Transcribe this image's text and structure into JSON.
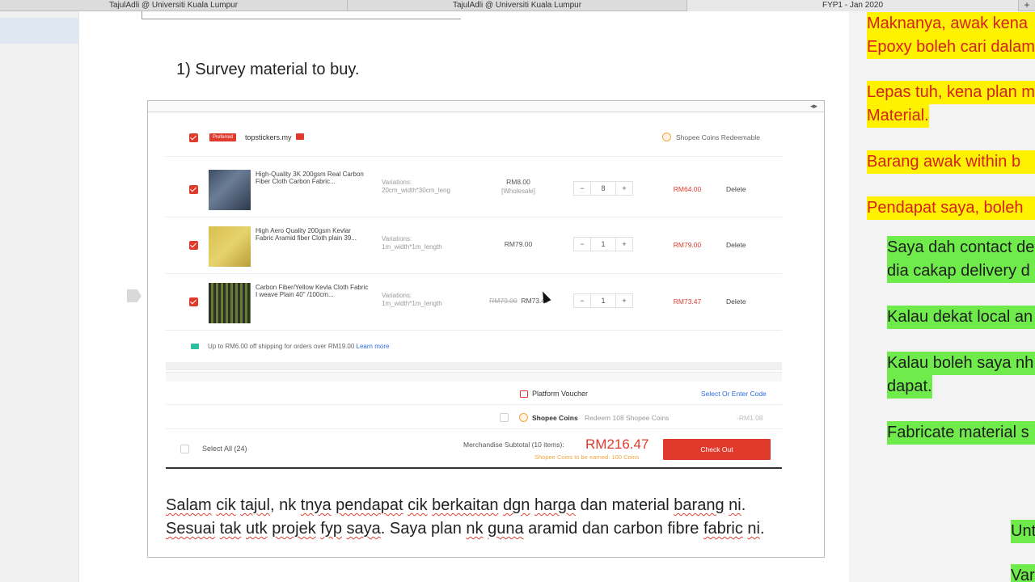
{
  "browser": {
    "tabs": [
      {
        "label": "TajulAdli @ Universiti Kuala Lumpur"
      },
      {
        "label": "TajulAdli @ Universiti Kuala Lumpur"
      },
      {
        "label": "FYP1 - Jan 2020"
      }
    ],
    "new_tab": "+"
  },
  "document": {
    "heading": "1) Survey material to buy.",
    "frame_nav": "◂▸",
    "comment_line1": [
      "Salam",
      "cik",
      "tajul",
      ", nk",
      "tnya",
      "pendapat",
      "cik",
      "berkaitan",
      "dgn",
      "harga",
      "dan material",
      "barang",
      "ni",
      "."
    ],
    "comment_line2": [
      "Sesuai",
      "tak",
      "utk",
      "projek",
      "fyp",
      "saya",
      ". Saya plan",
      "nk",
      "guna",
      "aramid dan carbon fibre",
      "fabric",
      "ni",
      "."
    ]
  },
  "shopee": {
    "badge": "Preferred",
    "shop_name": "topstickers.my",
    "coins_redeemable": "Shopee Coins Redeemable",
    "items": [
      {
        "name": "High-Quality 3K 200gsm Real Carbon Fiber Cloth Carbon Fabric...",
        "variation_label": "Variations:",
        "variation_value": "20cm_width*30cm_leng",
        "price": "RM8.00",
        "price_sub": "[Wholesale]",
        "qty": "8",
        "total": "RM64.00",
        "delete": "Delete"
      },
      {
        "name": "High Aero Quality 200gsm Kevlar Fabric Aramid fiber Cloth plain 39...",
        "variation_label": "Variations:",
        "variation_value": "1m_width*1m_length",
        "price": "RM79.00",
        "qty": "1",
        "total": "RM79.00",
        "delete": "Delete"
      },
      {
        "name": "Carbon Fiber/Yellow Kevla Cloth Fabric I weave Plain 40\" /100cm...",
        "variation_label": "Variations:",
        "variation_value": "1m_width*1m_length",
        "price_old": "RM79.00",
        "price": "RM73.47",
        "qty": "1",
        "total": "RM73.47",
        "delete": "Delete"
      }
    ],
    "qty_minus": "−",
    "qty_plus": "+",
    "shipping_text": "Up to RM6.00 off shipping for orders over RM19.00",
    "shipping_link": "Learn more",
    "voucher_label": "Platform Voucher",
    "voucher_link": "Select Or Enter Code",
    "coins_label": "Shopee Coins",
    "coins_redeem": "Redeem 108 Shopee Coins",
    "coins_amount": "-RM1.08",
    "select_all": "Select All (24)",
    "subtotal_label": "Merchandise Subtotal (10 items):",
    "subtotal_amount": "RM216.47",
    "coins_earned": "Shopee Coins to be earned: 100 Coins",
    "checkout": "Check Out"
  },
  "notes": {
    "yellow": [
      [
        "Maknanya, awak kena"
      ],
      [
        "Epoxy boleh cari dalam"
      ],
      [
        "Lepas tuh, kena plan m"
      ],
      [
        "Material."
      ],
      [
        "Barang awak within b"
      ],
      [
        "Pendapat saya, boleh"
      ]
    ],
    "green": [
      "Saya dah contact de",
      "dia cakap delivery d",
      "Kalau dekat local an",
      "Kalau boleh saya nh",
      "dapat.",
      "Fabricate material s",
      "Unt",
      "Var"
    ]
  },
  "colors": {
    "shopee_red": "#e03a2c",
    "highlight_yellow": "#fff200",
    "highlight_green": "#6fec4c",
    "note_red": "#d42020",
    "link_blue": "#2d6de0"
  }
}
